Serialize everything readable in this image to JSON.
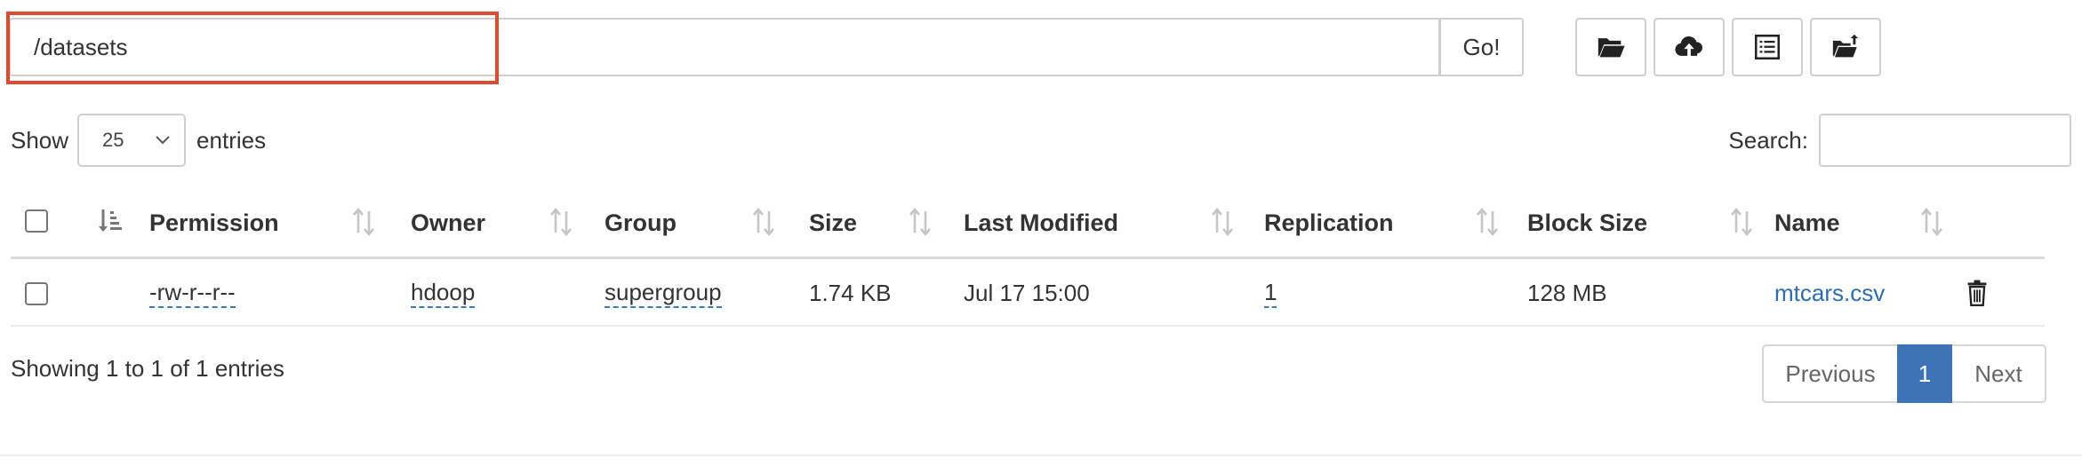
{
  "path": {
    "value": "/datasets",
    "go_label": "Go!"
  },
  "toolbar": {
    "icons": [
      "folder-open-icon",
      "cloud-upload-icon",
      "list-icon",
      "folder-upload-icon"
    ]
  },
  "length": {
    "show_label": "Show",
    "selected": "25",
    "entries_label": "entries"
  },
  "search": {
    "label": "Search:",
    "value": ""
  },
  "table": {
    "columns": [
      "Permission",
      "Owner",
      "Group",
      "Size",
      "Last Modified",
      "Replication",
      "Block Size",
      "Name"
    ],
    "rows": [
      {
        "permission": "-rw-r--r--",
        "owner": "hdoop",
        "group": "supergroup",
        "size": "1.74 KB",
        "last_modified": "Jul 17 15:00",
        "replication": "1",
        "block_size": "128 MB",
        "name": "mtcars.csv"
      }
    ]
  },
  "info": "Showing 1 to 1 of 1 entries",
  "pagination": {
    "previous": "Previous",
    "current": "1",
    "next": "Next"
  },
  "colors": {
    "highlight": "#e04a33",
    "link": "#2d6cb0",
    "active_page": "#3f73b8"
  }
}
